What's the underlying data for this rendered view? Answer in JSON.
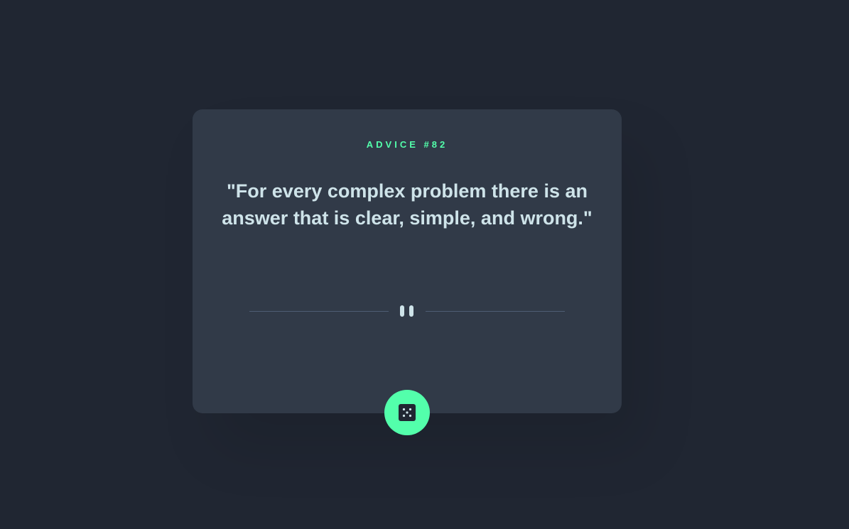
{
  "advice": {
    "title": "ADVICE #82",
    "quote": "\"For every complex problem there is an answer that is clear, simple, and wrong.\""
  },
  "divider": {
    "icon": "pause-icon"
  },
  "button": {
    "icon": "dice-icon"
  },
  "colors": {
    "background": "#202632",
    "card": "#313a48",
    "accent": "#53ffab",
    "text": "#cee3e9",
    "divider": "#4f5d74"
  }
}
